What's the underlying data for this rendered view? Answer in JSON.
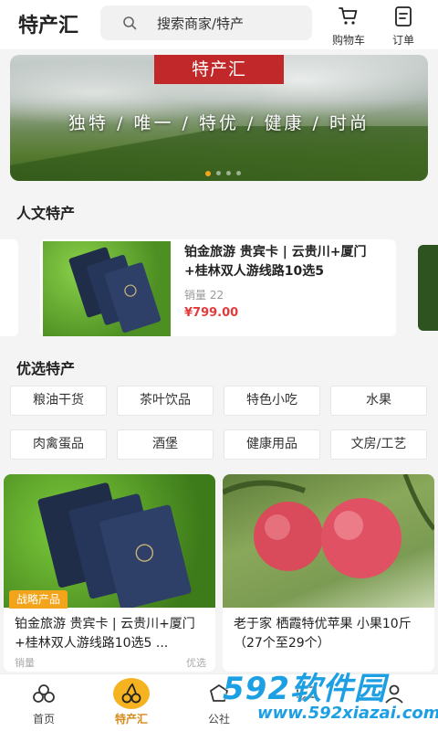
{
  "header": {
    "app_title": "特产汇",
    "search_placeholder": "搜索商家/特产",
    "cart_label": "购物车",
    "order_label": "订单"
  },
  "banner": {
    "tag": "特产汇",
    "slogan": "独特 / 唯一 / 特优 / 健康 / 时尚",
    "dot_count": 4,
    "active_dot": 1
  },
  "culture": {
    "title": "人文特产",
    "card": {
      "title": "铂金旅游 贵宾卡 | 云贵川+厦门+桂林双人游线路10选5",
      "sales": "销量 22",
      "price": "¥799.00"
    }
  },
  "preferred": {
    "title": "优选特产",
    "categories": [
      "粮油干货",
      "茶叶饮品",
      "特色小吃",
      "水果",
      "肉禽蛋品",
      "酒堡",
      "健康用品",
      "文房/工艺"
    ]
  },
  "products": [
    {
      "badge": "战略产品",
      "title": "铂金旅游 贵宾卡 | 云贵川+厦门+桂林双人游线路10选5 ...",
      "sub": "销量",
      "sub2": "优选"
    },
    {
      "badge": "",
      "title": "老于家 栖霞特优苹果 小果10斤（27个至29个）",
      "sub": "",
      "sub2": ""
    }
  ],
  "nav": {
    "items": [
      {
        "label": "首页",
        "icon": "home-icon"
      },
      {
        "label": "特产汇",
        "icon": "cherry-icon"
      },
      {
        "label": "公社",
        "icon": "community-icon"
      },
      {
        "label": "",
        "icon": "message-icon"
      },
      {
        "label": "",
        "icon": "user-icon"
      }
    ],
    "active_index": 1
  },
  "watermark": {
    "brand": "592软件园",
    "url": "www.592xiazai.com"
  },
  "colors": {
    "accent": "#f5b321",
    "price": "#e23b3b",
    "banner_tag": "#c0282a",
    "watermark": "#1d9fe3"
  }
}
